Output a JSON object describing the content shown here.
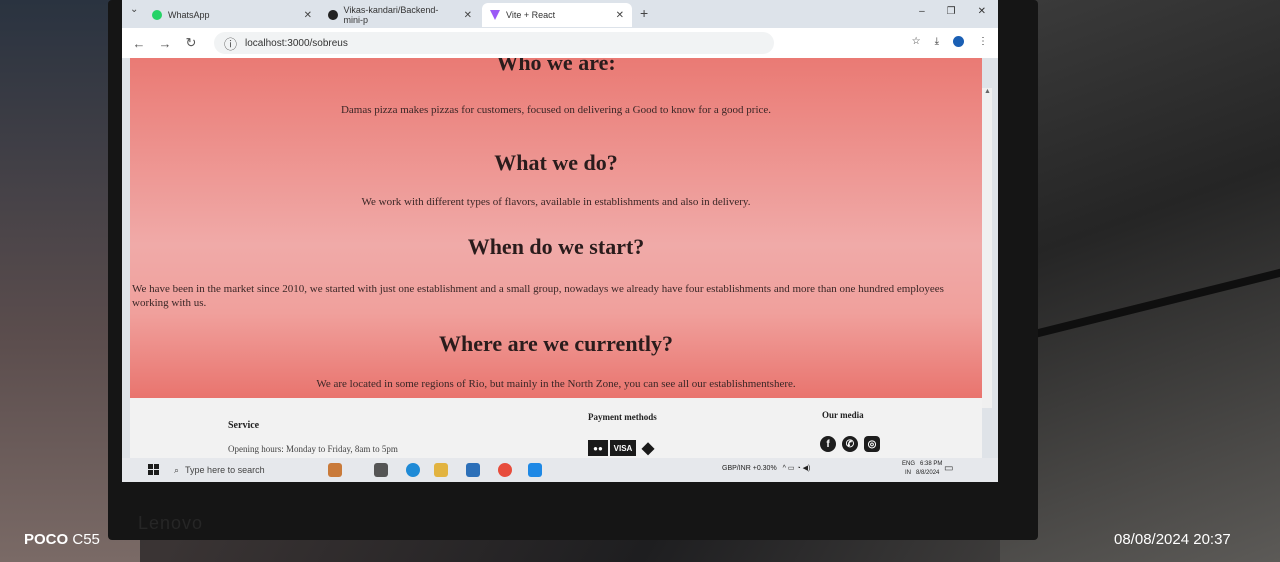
{
  "browser": {
    "tabs": [
      {
        "label": "WhatsApp"
      },
      {
        "label": "Vikas-kandari/Backend-mini-p"
      },
      {
        "label": "Vite + React"
      }
    ],
    "url": "localhost:3000/sobreus"
  },
  "page": {
    "sections": [
      {
        "heading": "Who we are:",
        "text": "Damas pizza makes pizzas for customers, focused on delivering a Good to know for a good price."
      },
      {
        "heading": "What we do?",
        "text": "We work with different types of flavors, available in establishments and also in delivery."
      },
      {
        "heading": "When do we start?",
        "text": "We have been in the market since 2010, we started with just one establishment and a small group, nowadays we already have four establishments and more than one hundred employees working with us."
      },
      {
        "heading": "Where are we currently?",
        "text": "We are located in some regions of Rio, but mainly in the North Zone, you can see all our establishmentshere."
      }
    ]
  },
  "footer": {
    "service_title": "Service",
    "hours": "Opening hours: Monday to Friday, 8am to 5pm",
    "payment_title": "Payment methods",
    "visa": "VISA",
    "media_title": "Our media"
  },
  "taskbar": {
    "search_placeholder": "Type here to search",
    "ticker": "GBP/INR +0.30%",
    "lang": "ENG",
    "region": "IN",
    "time": "6:38 PM",
    "date": "8/8/2024"
  },
  "camera": {
    "brand": "POCO",
    "model": "C55",
    "stamp": "08/08/2024  20:37"
  },
  "laptop": {
    "brand": "Lenovo"
  }
}
